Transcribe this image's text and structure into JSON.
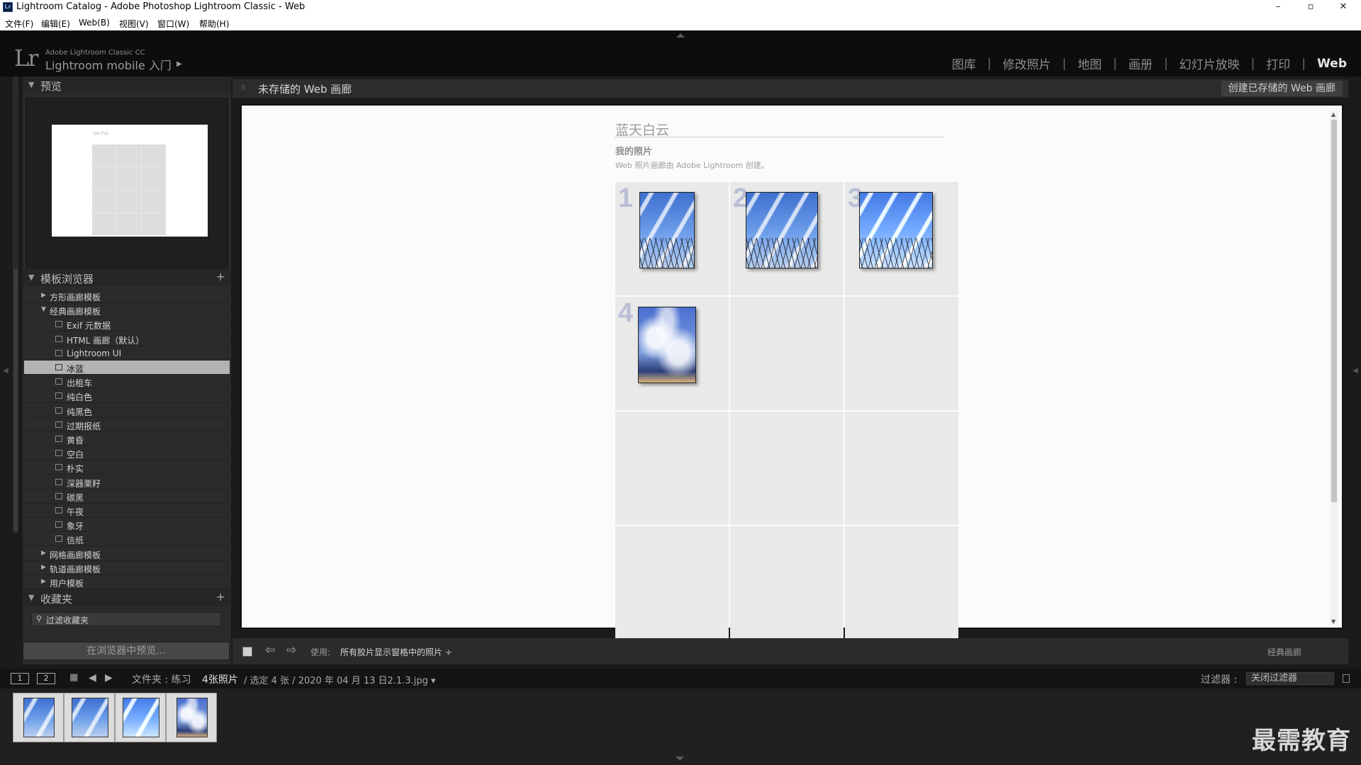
{
  "window": {
    "title": "Lightroom Catalog - Adobe Photoshop Lightroom Classic - Web",
    "icon_text": "Lr",
    "minimize": "–",
    "maximize": "▫",
    "close": "✕"
  },
  "menu": [
    "文件(F)",
    "编辑(E)",
    "Web(B)",
    "视图(V)",
    "窗口(W)",
    "帮助(H)"
  ],
  "header": {
    "logo": "Lr",
    "product": "Adobe Lightroom Classic CC",
    "mobile": "Lightroom mobile 入门",
    "mobile_arrow": "▶",
    "modules": [
      "图库",
      "修改照片",
      "地图",
      "画册",
      "幻灯片放映",
      "打印",
      "Web"
    ],
    "active_module": "Web",
    "separator": "|"
  },
  "left": {
    "preview_header": "预览",
    "template_header": "模板浏览器",
    "collections_header": "收藏夹",
    "preview_title_text": "Site Title",
    "tree": [
      {
        "label": "方形画廊模板",
        "level": 0,
        "state": "collapsed"
      },
      {
        "label": "经典画廊模板",
        "level": 0,
        "state": "expanded"
      },
      {
        "label": "Exif 元数据",
        "level": 1
      },
      {
        "label": "HTML 画廊（默认）",
        "level": 1
      },
      {
        "label": "Lightroom UI",
        "level": 1
      },
      {
        "label": "冰蓝",
        "level": 1,
        "selected": true
      },
      {
        "label": "出租车",
        "level": 1
      },
      {
        "label": "纯白色",
        "level": 1
      },
      {
        "label": "纯黑色",
        "level": 1
      },
      {
        "label": "过期报纸",
        "level": 1
      },
      {
        "label": "黄昏",
        "level": 1
      },
      {
        "label": "空白",
        "level": 1
      },
      {
        "label": "朴实",
        "level": 1
      },
      {
        "label": "深器栗籽",
        "level": 1
      },
      {
        "label": "碳黑",
        "level": 1
      },
      {
        "label": "午夜",
        "level": 1
      },
      {
        "label": "象牙",
        "level": 1
      },
      {
        "label": "信纸",
        "level": 1
      },
      {
        "label": "网格画廊模板",
        "level": 0,
        "state": "collapsed"
      },
      {
        "label": "轨道画廊模板",
        "level": 0,
        "state": "collapsed"
      },
      {
        "label": "用户模板",
        "level": 0,
        "state": "collapsed"
      }
    ],
    "collections_filter_placeholder": "过滤收藏夹",
    "preview_in_browser": "在浏览器中预览..."
  },
  "center": {
    "title": "未存储的 Web 画廊",
    "create_button": "创建已存储的 Web 画廊",
    "gallery": {
      "site_title": "蓝天白云",
      "collection_title": "我的照片",
      "credit": "Web 照片画廊由 Adobe Lightroom 创建。",
      "cell_numbers": [
        "1",
        "2",
        "3",
        "4"
      ]
    },
    "toolbar": {
      "use_label": "使用:",
      "use_value": "所有胶片显示窗格中的照片 ÷",
      "gallery_type": "经典画廊"
    }
  },
  "filmbar": {
    "view1": "1",
    "view2": "2",
    "source": "文件夹 : 练习",
    "count": "4张照片",
    "selection": "/ 选定 4 张 / 2020 年 04 月 13 日2.1.3.jpg ▾",
    "filter_label": "过滤器 :",
    "filter_value": "关闭过滤器"
  },
  "filmstrip": {
    "count": 4
  },
  "watermark": "最需教育",
  "colors": {
    "active_module": "#e6e6e6",
    "inactive_module": "#8d8d8d",
    "selected_row": "#b3b3b3",
    "gallery_bg": "#fbfbfb",
    "cell_bg": "#e9e9e9",
    "cell_number": "#b8bfd6"
  }
}
